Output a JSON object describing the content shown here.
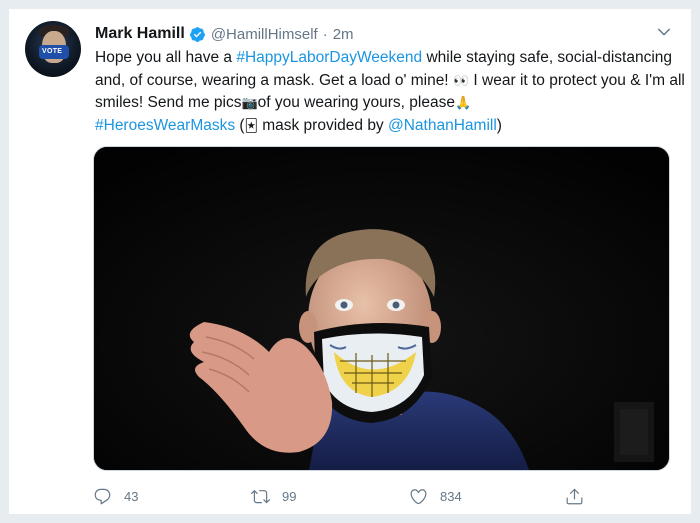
{
  "tweet": {
    "author": {
      "name": "Mark Hamill",
      "handle": "@HamillHimself",
      "separator": "·",
      "time": "2m",
      "avatar_mask_text": "VOTE"
    },
    "text": {
      "line1_prefix": "Hope you all have a ",
      "hashtag1": "#HappyLaborDayWeekend",
      "line1_suffix": " while staying safe, social-distancing and, of course, wearing a mask. Get a load o' mine! ",
      "eyes_emoji": "👀",
      "after_eyes": " I wear it to protect you & I'm all smiles! Send me pics",
      "camera_emoji": "📷",
      "after_camera": "of you wearing yours, please",
      "pray_emoji": "🙏",
      "hashtag2": "#HeroesWearMasks",
      "paren_open": " (",
      "joker_emoji": "🃏",
      "after_joker": " mask provided by ",
      "mention": "@NathanHamill",
      "paren_close": ")"
    },
    "stats": {
      "replies": "43",
      "retweets": "99",
      "likes": "834"
    },
    "colors": {
      "link": "#1b95e0",
      "verified": "#1da1f2",
      "muted": "#657786",
      "text": "#14171a"
    },
    "icons": {
      "verified": "verified-badge-icon",
      "caret": "chevron-down-icon",
      "reply": "reply-icon",
      "retweet": "retweet-icon",
      "like": "heart-icon",
      "share": "share-icon"
    }
  }
}
